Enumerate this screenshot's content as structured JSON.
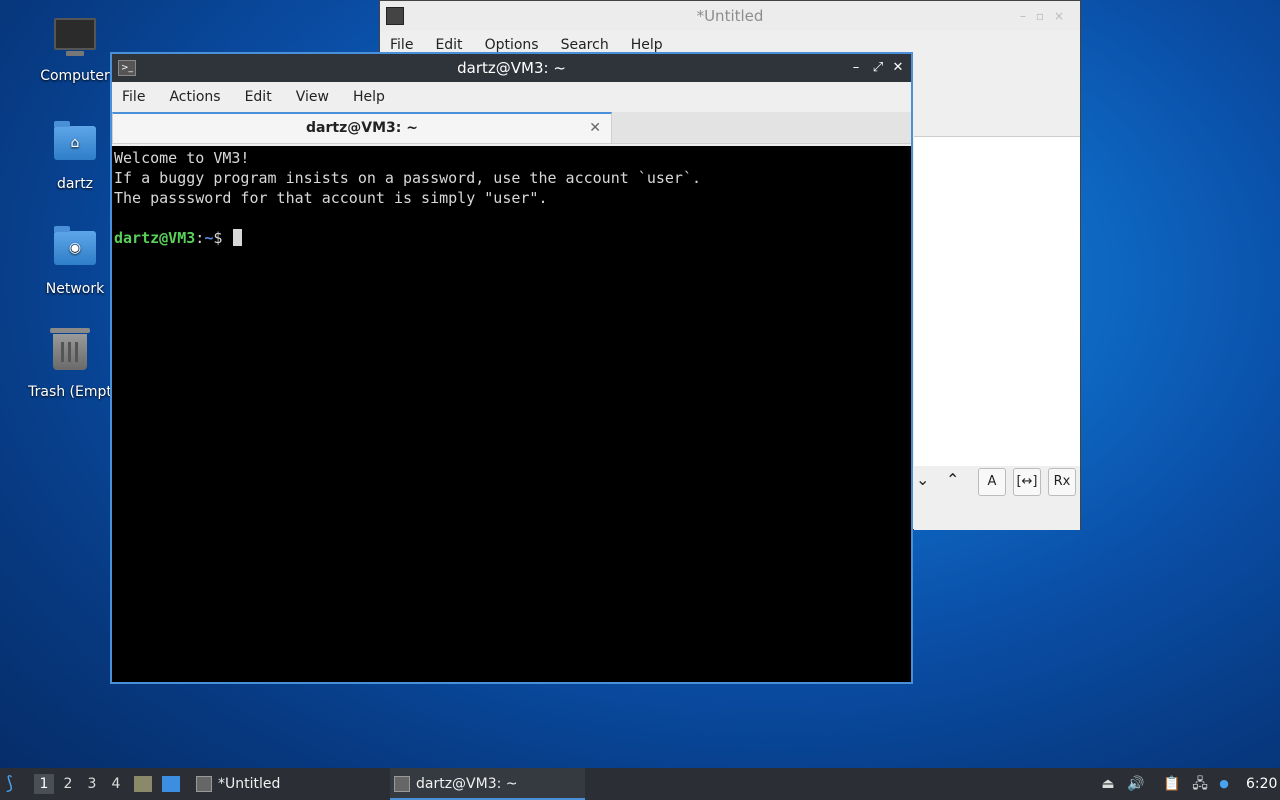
{
  "desktop": {
    "icons": [
      {
        "label": "Computer"
      },
      {
        "label": "dartz"
      },
      {
        "label": "Network"
      },
      {
        "label": "Trash (Empt"
      }
    ]
  },
  "editor": {
    "title": "*Untitled",
    "menu": [
      "File",
      "Edit",
      "Options",
      "Search",
      "Help"
    ],
    "search_buttons": {
      "match_case": "A",
      "whole_word": "[↔]",
      "regex": "Rx"
    }
  },
  "terminal": {
    "title": "dartz@VM3: ~",
    "menu": [
      "File",
      "Actions",
      "Edit",
      "View",
      "Help"
    ],
    "tab_label": "dartz@VM3: ~",
    "lines": [
      "Welcome to VM3!",
      "If a buggy program insists on a password, use the account `user`.",
      "The passsword for that account is simply \"user\"."
    ],
    "prompt_user": "dartz@VM3",
    "prompt_sep": ":",
    "prompt_path": "~",
    "prompt_symbol": "$ "
  },
  "taskbar": {
    "workspaces": [
      "1",
      "2",
      "3",
      "4"
    ],
    "tasks": [
      {
        "label": "*Untitled"
      },
      {
        "label": "dartz@VM3: ~"
      }
    ],
    "clock": "6:20"
  }
}
